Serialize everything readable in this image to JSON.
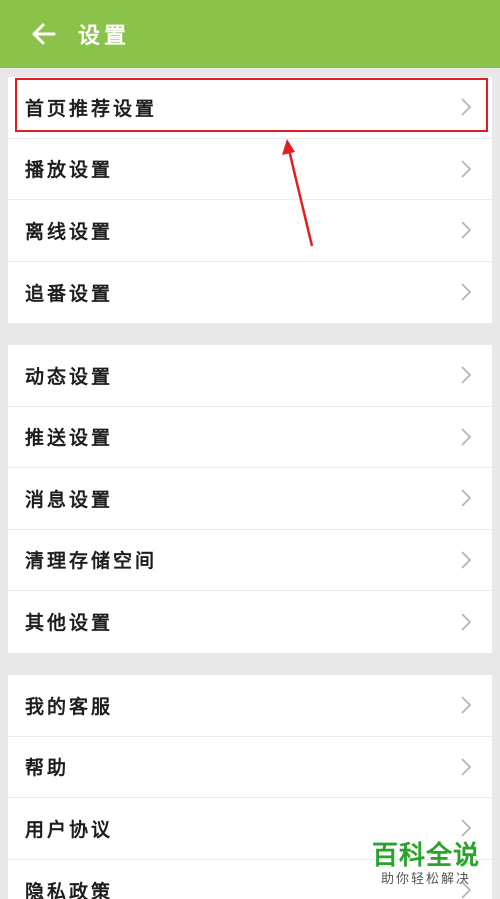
{
  "header": {
    "title": "设置",
    "back_icon": "arrow-left-icon",
    "background_color": "#8bc34a"
  },
  "groups": [
    {
      "items": [
        {
          "label": "首页推荐设置"
        },
        {
          "label": "播放设置"
        },
        {
          "label": "离线设置"
        },
        {
          "label": "追番设置"
        }
      ]
    },
    {
      "items": [
        {
          "label": "动态设置"
        },
        {
          "label": "推送设置"
        },
        {
          "label": "消息设置"
        },
        {
          "label": "清理存储空间"
        },
        {
          "label": "其他设置"
        }
      ]
    },
    {
      "items": [
        {
          "label": "我的客服"
        },
        {
          "label": "帮助"
        },
        {
          "label": "用户协议"
        },
        {
          "label": "隐私政策"
        }
      ]
    }
  ],
  "annotation": {
    "highlight_color": "#e02020"
  },
  "watermark": {
    "title": "百科全说",
    "subtitle": "助你轻松解决",
    "color": "#2aa32a"
  }
}
